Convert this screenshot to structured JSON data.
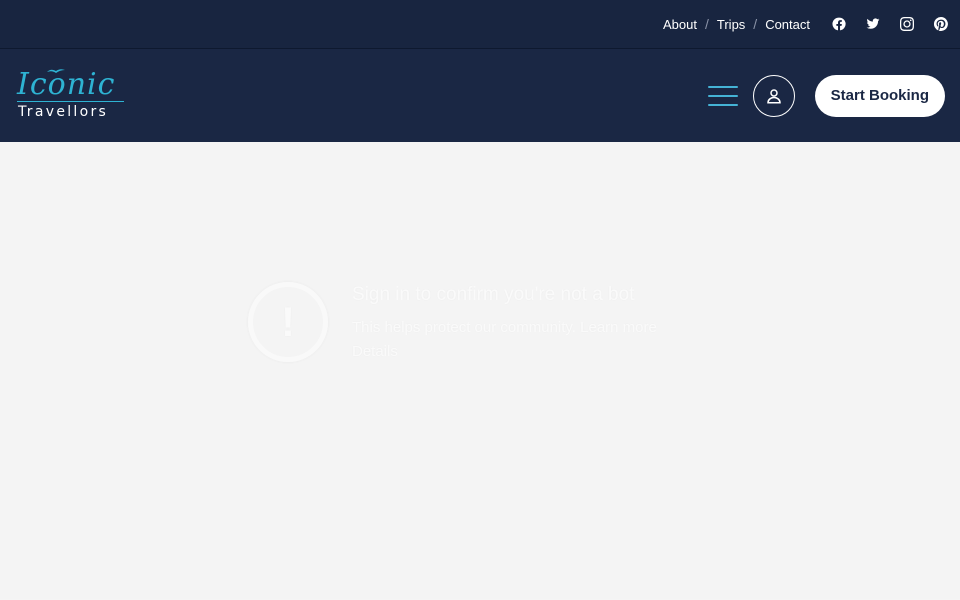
{
  "topbar": {
    "links": [
      "About",
      "Trips",
      "Contact"
    ],
    "separator": "/",
    "socials": [
      "facebook-icon",
      "twitter-icon",
      "instagram-icon",
      "pinterest-icon"
    ]
  },
  "header": {
    "logo": {
      "script": "Iconic",
      "sub": "Travellors"
    },
    "book_label": "Start Booking",
    "icons": [
      "hamburger-menu-icon",
      "user-icon"
    ]
  },
  "notice": {
    "title": "Sign in to confirm you're not a bot",
    "text": "This helps protect our community. Learn more",
    "link": "Details",
    "icon": "warning-icon"
  },
  "colors": {
    "topbar": "#182540",
    "header": "#1a2744",
    "accent": "#2eb3d3",
    "background": "#f4f4f4"
  }
}
